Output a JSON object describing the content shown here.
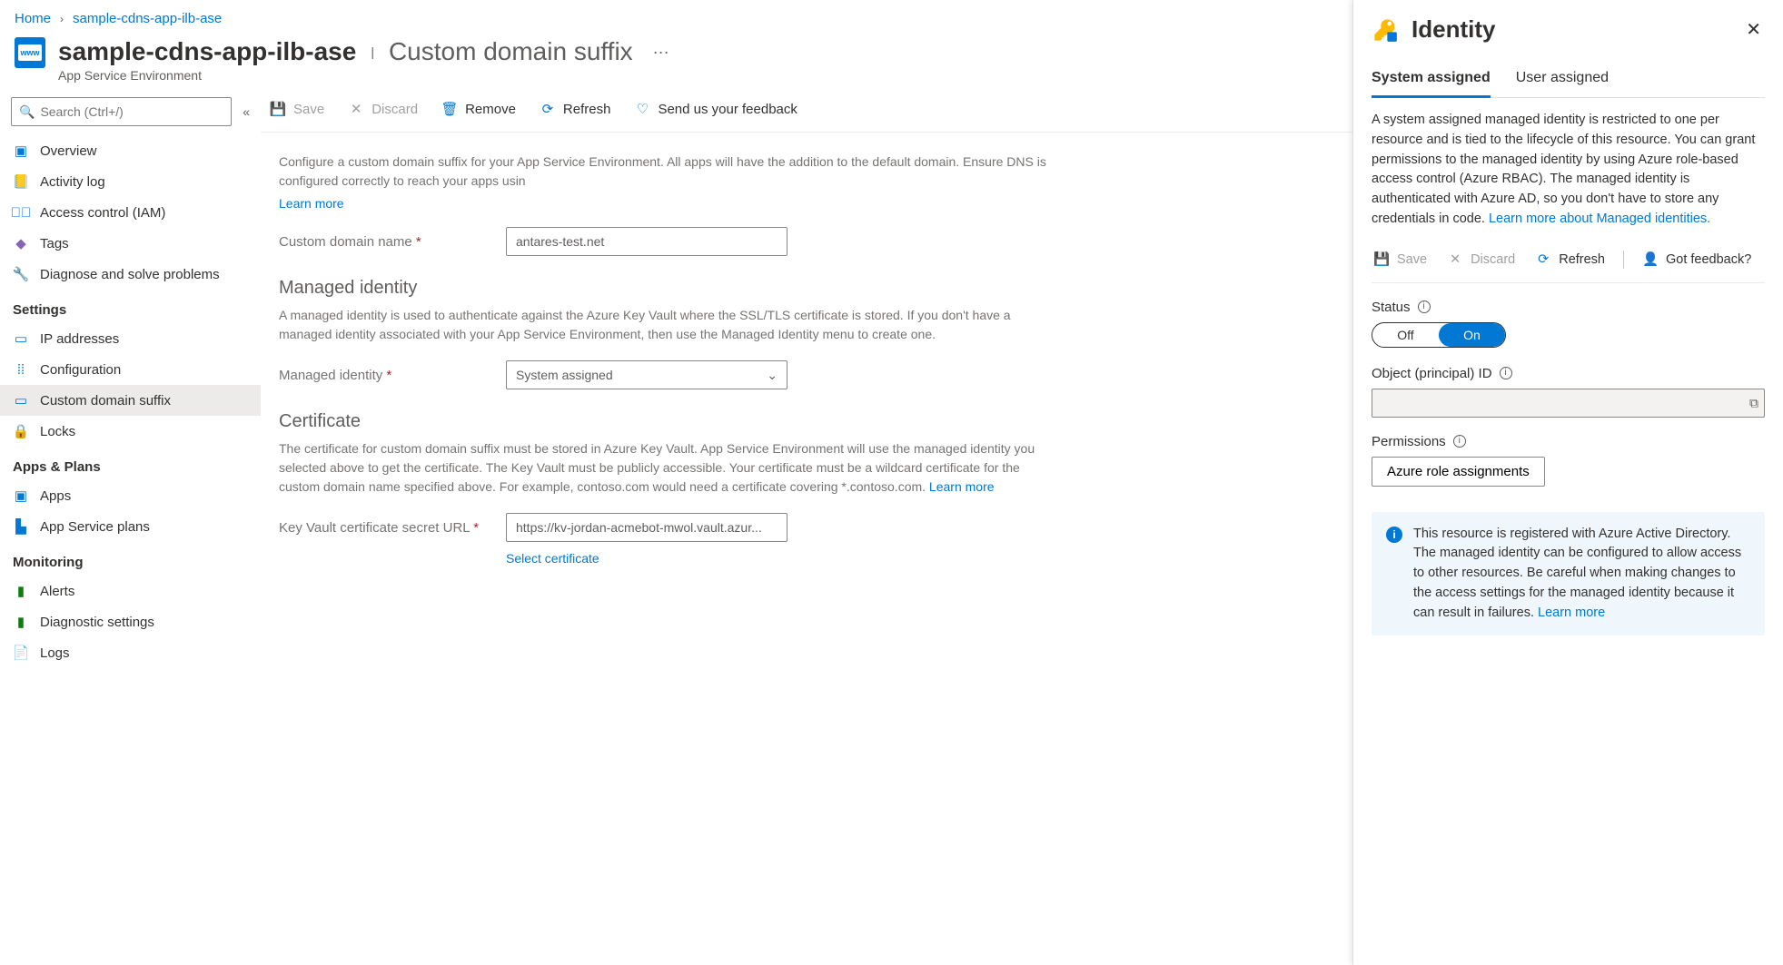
{
  "breadcrumb": {
    "home": "Home",
    "resource": "sample-cdns-app-ilb-ase"
  },
  "header": {
    "resource_name": "sample-cdns-app-ilb-ase",
    "section_name": "Custom domain suffix",
    "resource_type": "App Service Environment"
  },
  "search": {
    "placeholder": "Search (Ctrl+/)"
  },
  "nav": {
    "overview": "Overview",
    "activity": "Activity log",
    "access": "Access control (IAM)",
    "tags": "Tags",
    "diagnose": "Diagnose and solve problems",
    "g_settings": "Settings",
    "ip": "IP addresses",
    "config": "Configuration",
    "customdomain": "Custom domain suffix",
    "locks": "Locks",
    "g_apps": "Apps & Plans",
    "apps": "Apps",
    "plans": "App Service plans",
    "g_monitoring": "Monitoring",
    "alerts": "Alerts",
    "diag": "Diagnostic settings",
    "logs": "Logs"
  },
  "toolbar": {
    "save": "Save",
    "discard": "Discard",
    "remove": "Remove",
    "refresh": "Refresh",
    "feedback": "Send us your feedback"
  },
  "main": {
    "intro": "Configure a custom domain suffix for your App Service Environment. All apps will have the addition to the default domain. Ensure DNS is configured correctly to reach your apps usin",
    "learn_more": "Learn more",
    "custom_domain_label": "Custom domain name",
    "custom_domain_value": "antares-test.net",
    "mi_head": "Managed identity",
    "mi_desc": "A managed identity is used to authenticate against the Azure Key Vault where the SSL/TLS certificate is stored. If you don't have a managed identity associated with your App Service Environment, then use the Managed Identity menu to create one.",
    "mi_label": "Managed identity",
    "mi_value": "System assigned",
    "cert_head": "Certificate",
    "cert_desc": "The certificate for custom domain suffix must be stored in Azure Key Vault. App Service Environment will use the managed identity you selected above to get the certificate. The Key Vault must be publicly accessible. Your certificate must be a wildcard certificate for the custom domain name specified above. For example, contoso.com would need a certificate covering *.contoso.com.",
    "cert_learn": "Learn more",
    "cert_label": "Key Vault certificate secret URL",
    "cert_value": "https://kv-jordan-acmebot-mwol.vault.azur...",
    "select_cert": "Select certificate"
  },
  "blade": {
    "title": "Identity",
    "tab_system": "System assigned",
    "tab_user": "User assigned",
    "desc": "A system assigned managed identity is restricted to one per resource and is tied to the lifecycle of this resource. You can grant permissions to the managed identity by using Azure role-based access control (Azure RBAC). The managed identity is authenticated with Azure AD, so you don't have to store any credentials in code.",
    "desc_link": "Learn more about Managed identities.",
    "tb_save": "Save",
    "tb_discard": "Discard",
    "tb_refresh": "Refresh",
    "tb_feedback": "Got feedback?",
    "status_label": "Status",
    "toggle_off": "Off",
    "toggle_on": "On",
    "obj_label": "Object (principal) ID",
    "perm_label": "Permissions",
    "role_btn": "Azure role assignments",
    "info_msg": "This resource is registered with Azure Active Directory. The managed identity can be configured to allow access to other resources. Be careful when making changes to the access settings for the managed identity because it can result in failures.",
    "info_link": "Learn more"
  }
}
